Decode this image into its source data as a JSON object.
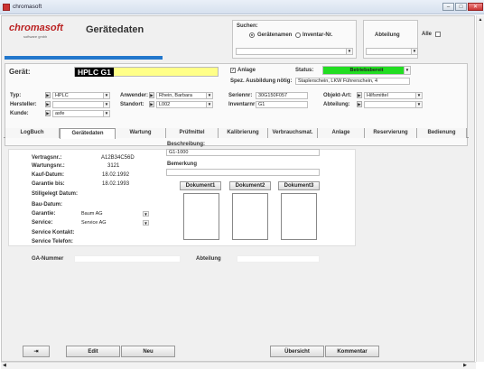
{
  "window": {
    "title": "chromasoft"
  },
  "logo": {
    "brand": "chromasoft",
    "tagline": "software gmbh"
  },
  "page": {
    "title": "Gerätedaten"
  },
  "search": {
    "label": "Suchen:",
    "option1": "Gerätenamen",
    "option2": "Inventar-Nr.",
    "abteilung_label": "Abteilung",
    "alle_label": "Alle"
  },
  "header": {
    "geraet_label": "Gerät:",
    "geraet_value": "HPLC G1",
    "anlage_label": "Anlage",
    "status_label": "Status:",
    "status_value": "Betriebsbereit",
    "spez_label": "Spez. Ausbildung nötig:",
    "spez_value": "Staplerschein, LKW Führerschein, 4",
    "typ_label": "Typ:",
    "typ_value": "HPLC",
    "hersteller_label": "Hersteller:",
    "hersteller_value": "",
    "kunde_label": "Kunde:",
    "kunde_value": "asfe",
    "anwender_label": "Anwender:",
    "anwender_value": "Rhein, Barbara",
    "standort_label": "Standort:",
    "standort_value": "L002",
    "seriennr_label": "Seriennr:",
    "seriennr_value": "30G150F057",
    "inventarnr_label": "Inventarnr:",
    "inventarnr_value": "G1",
    "objektart_label": "Objekt-Art:",
    "objektart_value": "Hilfsmittel",
    "abteilung_label": "Abteilung:",
    "abteilung_value": ""
  },
  "tabs": [
    "LogBuch",
    "Gerätedaten",
    "Wartung",
    "Prüfmittel",
    "Kalibrierung",
    "Verbrauchsmat.",
    "Anlage",
    "Reservierung",
    "Bedienung"
  ],
  "details": {
    "vertragsnr_label": "Vertragsnr.:",
    "vertragsnr_value": "A12B34C56D",
    "wartungsnr_label": "Wartungsnr.:",
    "wartungsnr_value": "3121",
    "kaufdatum_label": "Kauf-Datum:",
    "kaufdatum_value": "18.02.1992",
    "garantie_bis_label": "Garantie bis:",
    "garantie_bis_value": "18.02.1993",
    "stillgelegt_label": "Stillgelegt Datum:",
    "baudatum_label": "Bau-Datum:",
    "garantie_label": "Garantie:",
    "garantie_value": "Baum AG",
    "service_label": "Service:",
    "service_value": "Service AG",
    "service_kontakt_label": "Service Kontakt:",
    "service_telefon_label": "Service Telefon:",
    "beschreibung_label": "Beschreibung:",
    "beschreibung_value": "G1-1000",
    "bemerkung_label": "Bemerkung",
    "dokument1": "Dokument1",
    "dokument2": "Dokument2",
    "dokument3": "Dokument3",
    "ga_nummer_label": "GA-Nummer",
    "abteilung_label": "Abteilung"
  },
  "footer": {
    "edit": "Edit",
    "neu": "Neu",
    "uebersicht": "Übersicht",
    "kommentar": "Kommentar"
  }
}
